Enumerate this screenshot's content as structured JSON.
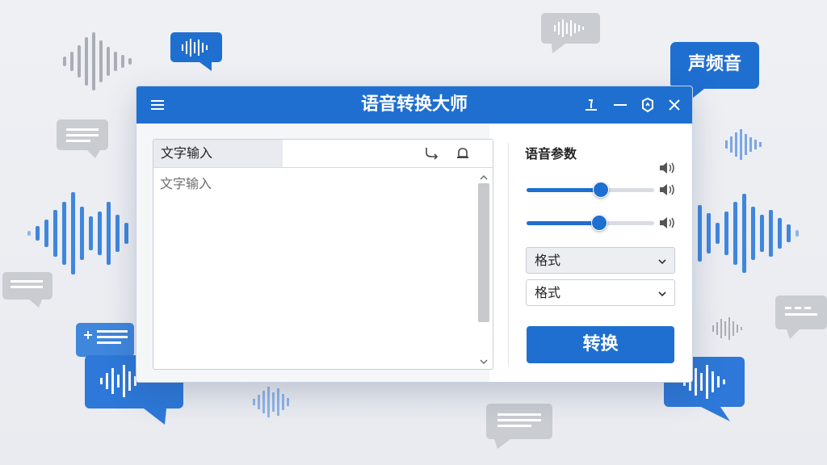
{
  "app": {
    "title": "语音转换大师"
  },
  "badge": {
    "text": "声频音"
  },
  "text_input": {
    "header_label": "文字输入",
    "placeholder": "文字输入"
  },
  "params": {
    "title": "语音参数",
    "slider_1_level": 0.58,
    "slider_2_level": 0.57,
    "select_1_value": "格式",
    "select_2_value": "格式"
  },
  "convert_button": {
    "label": "转换"
  },
  "colors": {
    "accent": "#1f6fd1",
    "background": "#eef0f4"
  },
  "icons": [
    "menu-icon",
    "pin-icon",
    "minimize-icon",
    "settings-icon",
    "close-icon",
    "export-icon",
    "bell-icon",
    "volume-icon",
    "chevron-down-icon"
  ]
}
